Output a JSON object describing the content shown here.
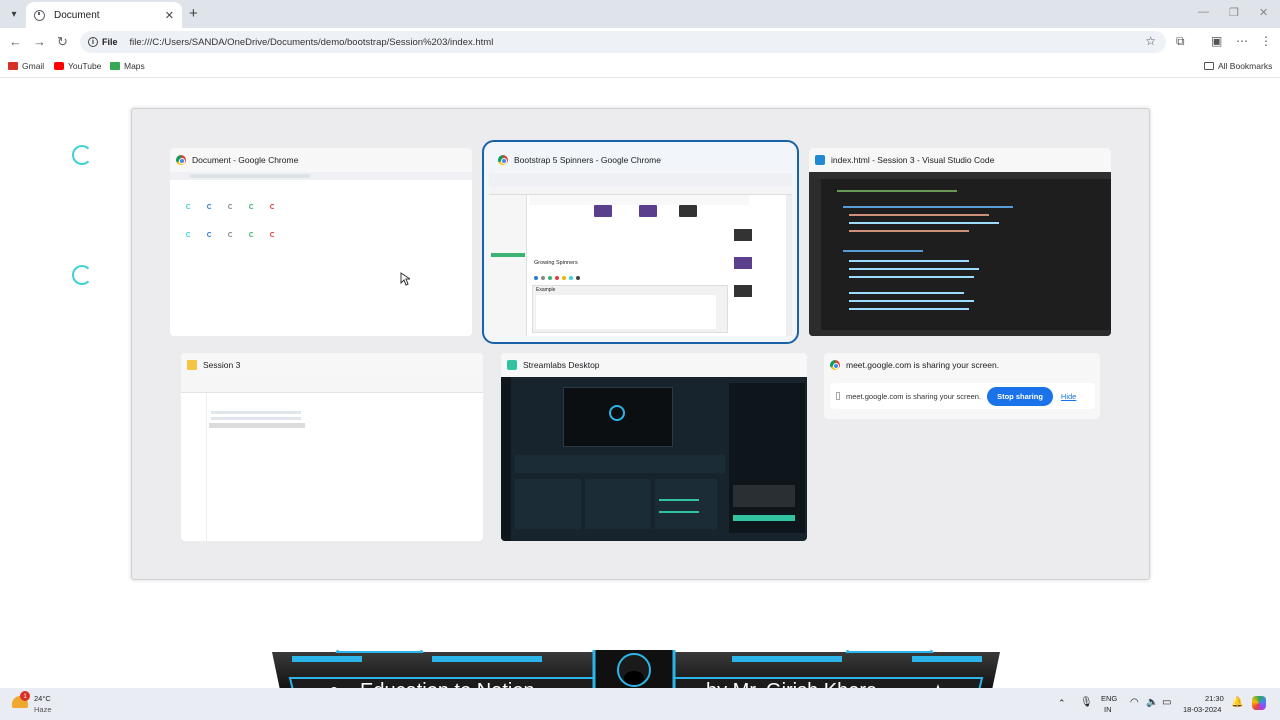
{
  "browser": {
    "tab_title": "Document",
    "new_tab": "+",
    "omnibox": {
      "chip": "File",
      "url": "file:///C:/Users/SANDA/OneDrive/Documents/demo/bootstrap/Session%203/index.html"
    },
    "bookmarks": [
      {
        "label": "Gmail",
        "color": "#d93025"
      },
      {
        "label": "YouTube",
        "color": "#ff0000"
      },
      {
        "label": "Maps",
        "color": "#34a853"
      }
    ],
    "all_bookmarks": "All Bookmarks"
  },
  "windows": [
    {
      "title": "Document - Google Chrome",
      "icon": "chrome-icon"
    },
    {
      "title": "Bootstrap 5 Spinners - Google Chrome",
      "icon": "chrome-icon",
      "selected": true
    },
    {
      "title": "index.html - Session 3 - Visual Studio Code",
      "icon": "vscode-icon"
    },
    {
      "title": "Session 3",
      "icon": "folder-icon"
    },
    {
      "title": "Streamlabs Desktop",
      "icon": "streamlabs-icon"
    },
    {
      "title": "meet.google.com is sharing your screen.",
      "icon": "chrome-icon"
    }
  ],
  "sharing": {
    "message": "meet.google.com is sharing your screen.",
    "stop_label": "Stop sharing",
    "hide_label": "Hide"
  },
  "bootstrap_thumb": {
    "heading": "Growing Spinners",
    "example": "Example"
  },
  "banner": {
    "left_text": "Education to Nation",
    "right_text": "by Mr. Girish Khera",
    "colors": {
      "accent": "#2bb5e8",
      "dark": "#1c1c1c"
    }
  },
  "taskbar": {
    "weather_temp": "24°C",
    "weather_desc": "Haze",
    "weather_badge": "1",
    "lang_1": "ENG",
    "lang_2": "IN",
    "time": "21:30",
    "date": "18-03-2024"
  }
}
